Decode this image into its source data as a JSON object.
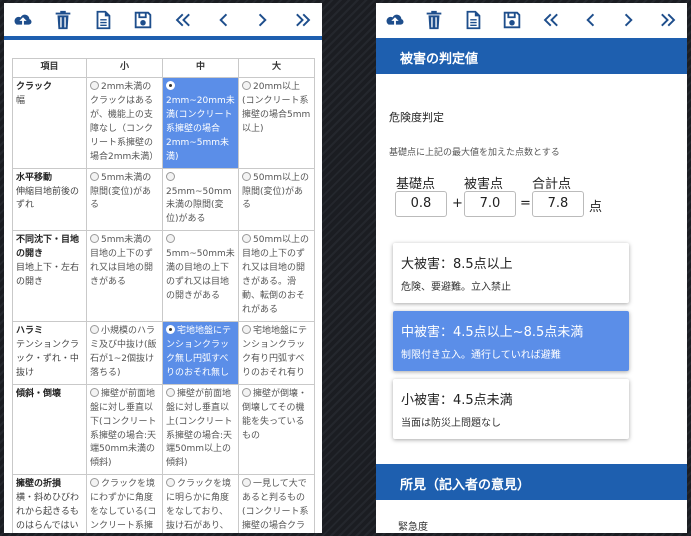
{
  "toolbar": {
    "icons": [
      "cloud-upload-icon",
      "trash-icon",
      "document-icon",
      "save-icon",
      "first-page-icon",
      "prev-page-icon",
      "next-page-icon",
      "last-page-icon"
    ]
  },
  "table": {
    "headers": [
      "項目",
      "小",
      "中",
      "大"
    ],
    "rows": [
      {
        "title": "クラック",
        "sub": "幅",
        "options": [
          "2mm未満のクラックはあるが、機能上の支障なし（コンクリート系擁壁の場合2mm未満）",
          "2mm~20mm未満(コンクリート系擁壁の場合2mm~5mm未満)",
          "20mm以上(コンクリート系擁壁の場合5mm以上)"
        ],
        "selected": 1
      },
      {
        "title": "水平移動",
        "sub": "伸縮目地前後のずれ",
        "options": [
          "5mm未満の隙間(変位)がある",
          "25mm~50mm未満の隙間(変位)がある",
          "50mm以上の隙間(変位)がある"
        ],
        "selected": -1
      },
      {
        "title": "不同沈下・目地の開き",
        "sub": "目地上下・左右の開き",
        "options": [
          "5mm未満の目地の上下のずれ又は目地の開きがある",
          "5mm~50mm未満の目地の上下のずれ又は目地の開きがある",
          "50mm以上の目地の上下のずれ又は目地の開きがある。滑動、転倒のおそれがある"
        ],
        "selected": -1
      },
      {
        "title": "ハラミ",
        "sub": "テンションクラック・ずれ・中抜け",
        "options": [
          "小規模のハラミ及び中抜け(飯石が1~2個抜け落ちる)",
          "宅地地盤にテンションクラック無し円弧すべりのおそれ無し",
          "宅地地盤にテンションクラック有り円弧すべりのおそれ有り"
        ],
        "selected": 1
      },
      {
        "title": "傾斜・倒壊",
        "sub": "",
        "options": [
          "擁壁が前面地盤に対し垂直以下(コンクリート系擁壁の場合:天端50mm未満の傾斜)",
          "擁壁が前面地盤に対し垂直以上(コンクリート系擁壁の場合:天端50mm以上の傾斜)",
          "擁壁が倒壊・倒壊してその機能を失っているもの"
        ],
        "selected": -1
      },
      {
        "title": "擁壁の折損",
        "sub": "横・斜めひびわれから起きるものはらんではい",
        "options": [
          "クラックを境にわずかに角度をなしている(コンクリート系擁壁の場合がク",
          "クラックを境に明らかに角度をなしており、抜け石があり、裏込",
          "一見して大であると判るもの(コンクリート系擁壁の場合クラックを境に"
        ],
        "selected": -1
      }
    ]
  },
  "judgement": {
    "section_title": "被害の判定値",
    "subtitle": "危険度判定",
    "note": "基礎点に上記の最大値を加えた点数とする",
    "labels": {
      "base": "基礎点",
      "damage": "被害点",
      "total": "合計点"
    },
    "values": {
      "base": "0.8",
      "damage": "7.0",
      "total": "7.8"
    },
    "ops": {
      "plus": "+",
      "equals": "=",
      "unit": "点"
    },
    "levels": [
      {
        "title": "大被害：8.5点以上",
        "desc": "危険、要避難。立入禁止",
        "active": false
      },
      {
        "title": "中被害：4.5点以上~8.5点未満",
        "desc": "制限付き立入。通行していれば避難",
        "active": true
      },
      {
        "title": "小被害：4.5点未満",
        "desc": "当面は防災上問題なし",
        "active": false
      }
    ]
  },
  "opinion": {
    "section_title": "所見（記入者の意見）",
    "field_label": "緊急度"
  }
}
